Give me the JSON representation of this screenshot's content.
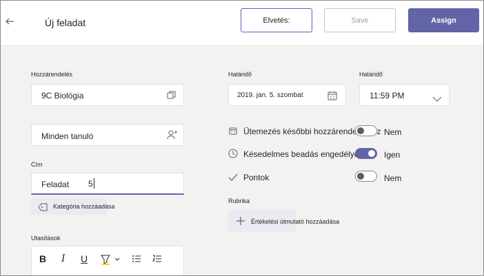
{
  "header": {
    "title": "Új feladat",
    "discard_label": "Elvetés:",
    "save_label": "Save",
    "assign_label": "Assign"
  },
  "left": {
    "assign_to_label": "Hozzárendelés",
    "class_value": "9C Biológia",
    "students_value": "Minden tanuló",
    "title_label": "Cím",
    "title_value": "Feladat",
    "title_counter": "5",
    "category_label": "Kategória hozzáadása",
    "instructions_label": "Utasítások"
  },
  "right": {
    "due_date_label": "Határidő",
    "due_date_value": "2019. jan. 5. szombat",
    "due_time_label": "Határidő",
    "due_time_value": "11:59 PM",
    "options": [
      {
        "label": "Ütemezés későbbi hozzárendeléshez",
        "value": "Nem",
        "on": false,
        "icon": "calendar-icon"
      },
      {
        "label": "Késedelmes beadás engedélyezett",
        "value": "Igen",
        "on": true,
        "icon": "clock-icon"
      },
      {
        "label": "Pontok",
        "value": "Nem",
        "on": false,
        "icon": "check-icon"
      }
    ],
    "rubric_label": "Rubrika",
    "rubric_button_label": "Értékelési útmutató hozzáadása"
  },
  "toolbar": {
    "bold": "B",
    "italic": "I",
    "underline": "U"
  },
  "colors": {
    "accent": "#6264a7",
    "background": "#f3f2f1"
  }
}
